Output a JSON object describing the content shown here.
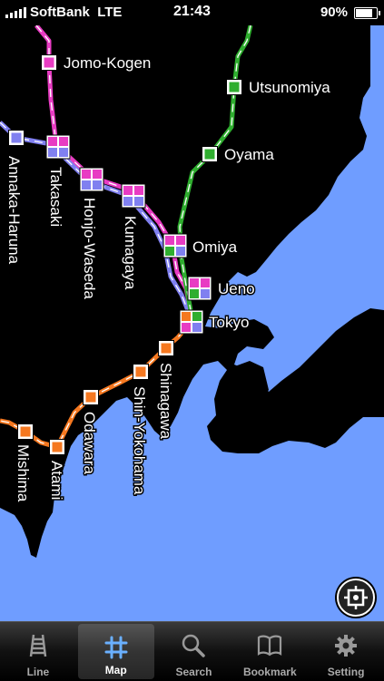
{
  "status_bar": {
    "carrier": "SoftBank",
    "network": "LTE",
    "time": "21:43",
    "battery_percent": "90%",
    "battery_level": 0.9
  },
  "map": {
    "colors": {
      "sea": "#6f9dff",
      "land": "#000000",
      "line_pink": "#e83cc3",
      "line_blue": "#8080f0",
      "line_green": "#2fae2f",
      "line_orange": "#f57820"
    },
    "stations": [
      {
        "name": "Jomo-Kogen"
      },
      {
        "name": "Utsunomiya"
      },
      {
        "name": "Oyama"
      },
      {
        "name": "Annaka-Haruna"
      },
      {
        "name": "Takasaki"
      },
      {
        "name": "Honjo-Waseda"
      },
      {
        "name": "Kumagaya"
      },
      {
        "name": "Omiya"
      },
      {
        "name": "Ueno"
      },
      {
        "name": "Tokyo"
      },
      {
        "name": "Shinagawa"
      },
      {
        "name": "Shin-Yokohama"
      },
      {
        "name": "Odawara"
      },
      {
        "name": "Atami"
      },
      {
        "name": "Mishima"
      }
    ]
  },
  "locate_button": {
    "icon": "locate-icon"
  },
  "tabs": [
    {
      "label": "Line",
      "icon": "rail-icon",
      "active": false
    },
    {
      "label": "Map",
      "icon": "grid-icon",
      "active": true
    },
    {
      "label": "Search",
      "icon": "search-icon",
      "active": false
    },
    {
      "label": "Bookmark",
      "icon": "book-icon",
      "active": false
    },
    {
      "label": "Setting",
      "icon": "gear-icon",
      "active": false
    }
  ]
}
